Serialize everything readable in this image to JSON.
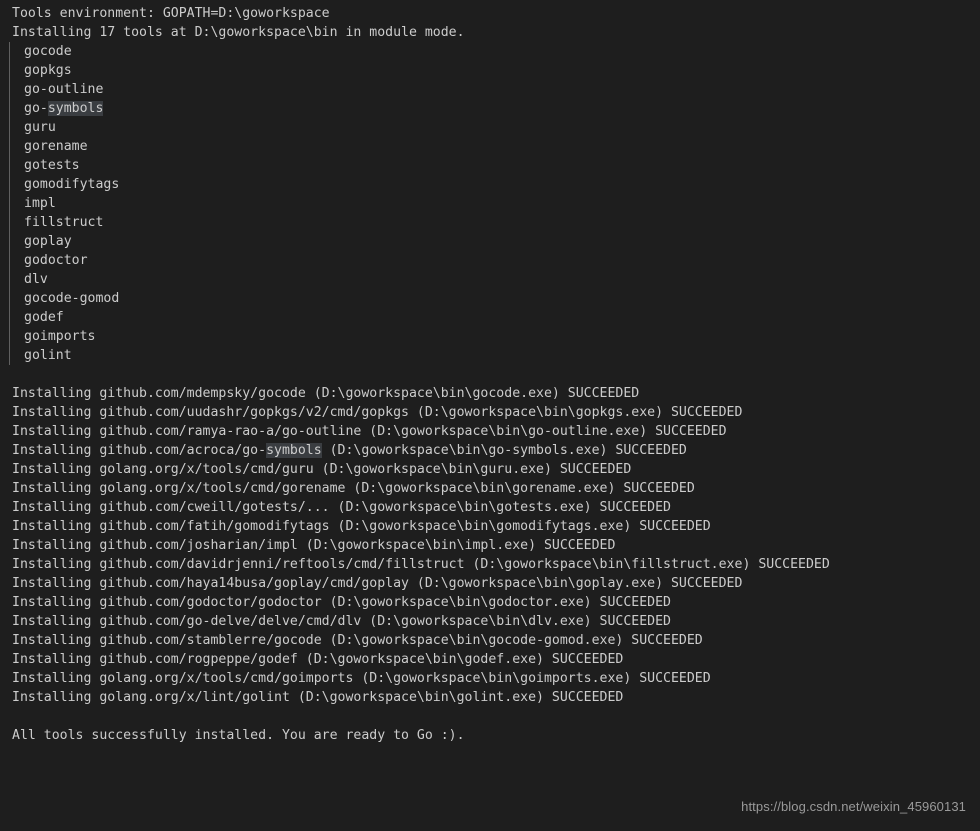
{
  "terminal": {
    "background_color": "#1e1e1e",
    "foreground_color": "#cccccc",
    "highlight_color": "#3a3d41",
    "indent_guide_color": "#606060",
    "header_lines": [
      "Tools environment: GOPATH=D:\\goworkspace",
      "Installing 17 tools at D:\\goworkspace\\bin in module mode."
    ],
    "tool_list": [
      {
        "prefix": "gocode",
        "highlight": "",
        "suffix": ""
      },
      {
        "prefix": "gopkgs",
        "highlight": "",
        "suffix": ""
      },
      {
        "prefix": "go-outline",
        "highlight": "",
        "suffix": ""
      },
      {
        "prefix": "go-",
        "highlight": "symbols",
        "suffix": ""
      },
      {
        "prefix": "guru",
        "highlight": "",
        "suffix": ""
      },
      {
        "prefix": "gorename",
        "highlight": "",
        "suffix": ""
      },
      {
        "prefix": "gotests",
        "highlight": "",
        "suffix": ""
      },
      {
        "prefix": "gomodifytags",
        "highlight": "",
        "suffix": ""
      },
      {
        "prefix": "impl",
        "highlight": "",
        "suffix": ""
      },
      {
        "prefix": "fillstruct",
        "highlight": "",
        "suffix": ""
      },
      {
        "prefix": "goplay",
        "highlight": "",
        "suffix": ""
      },
      {
        "prefix": "godoctor",
        "highlight": "",
        "suffix": ""
      },
      {
        "prefix": "dlv",
        "highlight": "",
        "suffix": ""
      },
      {
        "prefix": "gocode-gomod",
        "highlight": "",
        "suffix": ""
      },
      {
        "prefix": "godef",
        "highlight": "",
        "suffix": ""
      },
      {
        "prefix": "goimports",
        "highlight": "",
        "suffix": ""
      },
      {
        "prefix": "golint",
        "highlight": "",
        "suffix": ""
      }
    ],
    "install_lines": [
      {
        "prefix": "Installing github.com/mdempsky/gocode (D:\\goworkspace\\bin\\gocode.exe) SUCCEEDED",
        "highlight": "",
        "suffix": ""
      },
      {
        "prefix": "Installing github.com/uudashr/gopkgs/v2/cmd/gopkgs (D:\\goworkspace\\bin\\gopkgs.exe) SUCCEEDED",
        "highlight": "",
        "suffix": ""
      },
      {
        "prefix": "Installing github.com/ramya-rao-a/go-outline (D:\\goworkspace\\bin\\go-outline.exe) SUCCEEDED",
        "highlight": "",
        "suffix": ""
      },
      {
        "prefix": "Installing github.com/acroca/go-",
        "highlight": "symbols",
        "suffix": " (D:\\goworkspace\\bin\\go-symbols.exe) SUCCEEDED"
      },
      {
        "prefix": "Installing golang.org/x/tools/cmd/guru (D:\\goworkspace\\bin\\guru.exe) SUCCEEDED",
        "highlight": "",
        "suffix": ""
      },
      {
        "prefix": "Installing golang.org/x/tools/cmd/gorename (D:\\goworkspace\\bin\\gorename.exe) SUCCEEDED",
        "highlight": "",
        "suffix": ""
      },
      {
        "prefix": "Installing github.com/cweill/gotests/... (D:\\goworkspace\\bin\\gotests.exe) SUCCEEDED",
        "highlight": "",
        "suffix": ""
      },
      {
        "prefix": "Installing github.com/fatih/gomodifytags (D:\\goworkspace\\bin\\gomodifytags.exe) SUCCEEDED",
        "highlight": "",
        "suffix": ""
      },
      {
        "prefix": "Installing github.com/josharian/impl (D:\\goworkspace\\bin\\impl.exe) SUCCEEDED",
        "highlight": "",
        "suffix": ""
      },
      {
        "prefix": "Installing github.com/davidrjenni/reftools/cmd/fillstruct (D:\\goworkspace\\bin\\fillstruct.exe) SUCCEEDED",
        "highlight": "",
        "suffix": ""
      },
      {
        "prefix": "Installing github.com/haya14busa/goplay/cmd/goplay (D:\\goworkspace\\bin\\goplay.exe) SUCCEEDED",
        "highlight": "",
        "suffix": ""
      },
      {
        "prefix": "Installing github.com/godoctor/godoctor (D:\\goworkspace\\bin\\godoctor.exe) SUCCEEDED",
        "highlight": "",
        "suffix": ""
      },
      {
        "prefix": "Installing github.com/go-delve/delve/cmd/dlv (D:\\goworkspace\\bin\\dlv.exe) SUCCEEDED",
        "highlight": "",
        "suffix": ""
      },
      {
        "prefix": "Installing github.com/stamblerre/gocode (D:\\goworkspace\\bin\\gocode-gomod.exe) SUCCEEDED",
        "highlight": "",
        "suffix": ""
      },
      {
        "prefix": "Installing github.com/rogpeppe/godef (D:\\goworkspace\\bin\\godef.exe) SUCCEEDED",
        "highlight": "",
        "suffix": ""
      },
      {
        "prefix": "Installing golang.org/x/tools/cmd/goimports (D:\\goworkspace\\bin\\goimports.exe) SUCCEEDED",
        "highlight": "",
        "suffix": ""
      },
      {
        "prefix": "Installing golang.org/x/lint/golint (D:\\goworkspace\\bin\\golint.exe) SUCCEEDED",
        "highlight": "",
        "suffix": ""
      }
    ],
    "footer_lines": [
      "All tools successfully installed. You are ready to Go :)."
    ]
  },
  "watermark": {
    "text": "https://blog.csdn.net/weixin_45960131"
  }
}
